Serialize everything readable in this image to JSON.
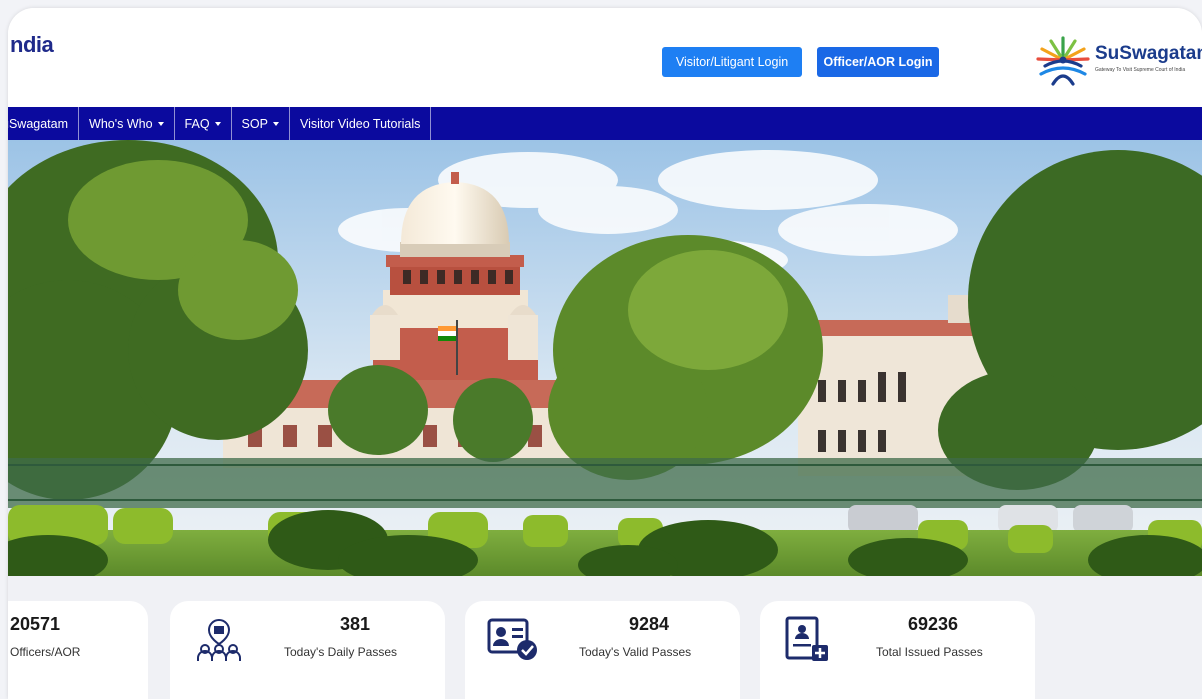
{
  "header": {
    "brand_text": "ndia",
    "visitor_login_label": "Visitor/Litigant Login",
    "officer_login_label": "Officer/AOR Login",
    "logo_name": "SuSwagatam",
    "logo_tagline": "Gateway To Visit Supreme Court of India"
  },
  "nav": {
    "items": [
      {
        "label": "uSwagatam"
      },
      {
        "label": "Who's Who"
      },
      {
        "label": "FAQ"
      },
      {
        "label": "SOP"
      },
      {
        "label": "Visitor Video Tutorials"
      }
    ]
  },
  "stats": [
    {
      "value": "20571",
      "label": "Officers/AOR",
      "icon": "officers-icon"
    },
    {
      "value": "381",
      "label": "Today's Daily Passes",
      "icon": "daily-passes-icon"
    },
    {
      "value": "9284",
      "label": "Today's Valid Passes",
      "icon": "valid-passes-icon"
    },
    {
      "value": "69236",
      "label": "Total Issued Passes",
      "icon": "issued-passes-icon"
    }
  ],
  "colors": {
    "nav_bg": "#0b0a9e",
    "button_blue": "#1e7ff3",
    "icon_navy": "#1d2b6b"
  }
}
